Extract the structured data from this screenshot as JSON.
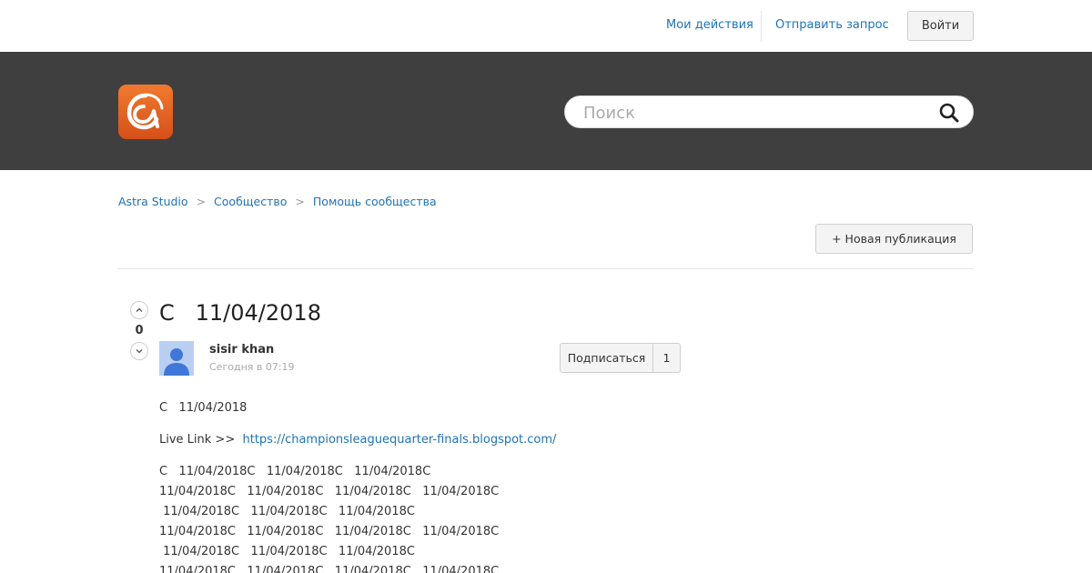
{
  "topbar": {
    "my_actions": "Мои действия",
    "submit_request": "Отправить запрос",
    "login": "Войти"
  },
  "hero": {
    "logo_icon": "astra-logo-icon",
    "search_placeholder": "Поиск",
    "search_icon": "search-icon"
  },
  "breadcrumb": {
    "items": [
      "Astra Studio",
      "Сообщество",
      "Помощь сообщества"
    ],
    "separator": ">"
  },
  "actions": {
    "new_post": "+ Новая публикация"
  },
  "post": {
    "votes": "0",
    "title": "С   11/04/2018",
    "author": "sisir khan",
    "time": "Сегодня в 07:19",
    "subscribe_label": "Подписаться",
    "subscribe_count": "1",
    "body_first": "С   11/04/2018",
    "live_link_label": "Live Link >>  ",
    "live_link_url": "https://championsleaguequarter-finals.blogspot.com/",
    "body_lines": [
      "С   11/04/2018С   11/04/2018С   11/04/2018С",
      "11/04/2018С   11/04/2018С   11/04/2018С   11/04/2018С",
      " 11/04/2018С   11/04/2018С   11/04/2018С",
      "11/04/2018С   11/04/2018С   11/04/2018С   11/04/2018С",
      " 11/04/2018С   11/04/2018С   11/04/2018С",
      "11/04/2018С   11/04/2018С   11/04/2018С   11/04/2018С"
    ]
  },
  "colors": {
    "accent": "#1f73b7",
    "hero_bg": "#3f3f3f",
    "logo_orange": "#e8612a"
  }
}
